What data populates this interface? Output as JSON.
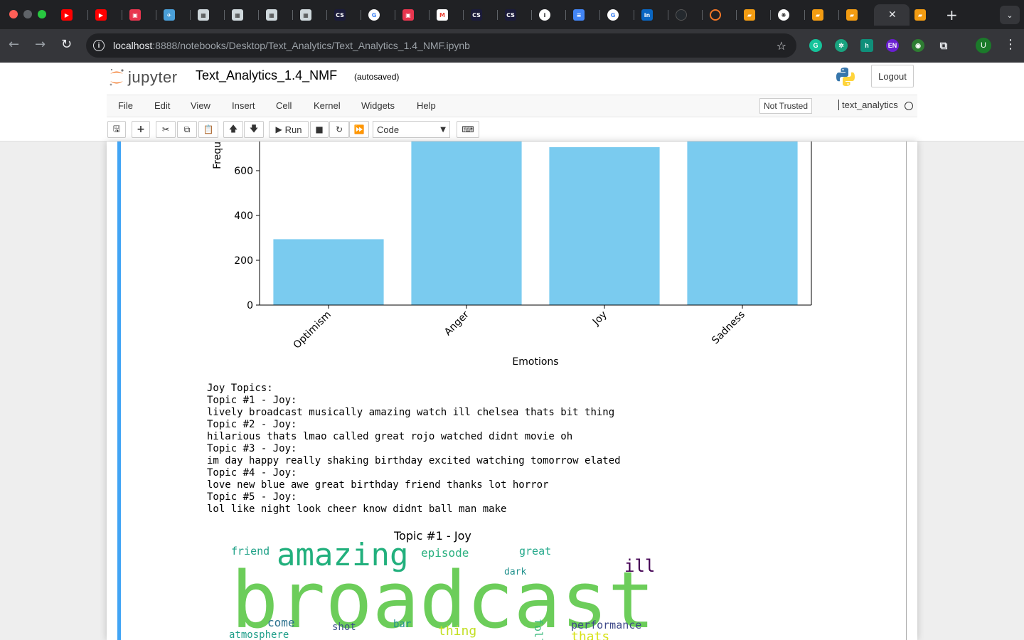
{
  "browser": {
    "url_host": "localhost",
    "url_rest": ":8888/notebooks/Desktop/Text_Analytics/Text_Analytics_1.4_NMF.ipynb",
    "profile_initial": "U",
    "ext_en": "EN",
    "ext_h": "h",
    "fav_cs": "CS",
    "icons": [
      "back-arrow-icon",
      "forward-arrow-icon",
      "reload-icon",
      "site-info-icon",
      "bookmark-star-icon",
      "grammarly-icon",
      "chatgpt-icon",
      "hypothesis-icon",
      "extensions-puzzle-icon",
      "menu-dots-icon"
    ]
  },
  "jupyter": {
    "logo_text": "jupyter",
    "notebook_name": "Text_Analytics_1.4_NMF",
    "autosave_status": "(autosaved)",
    "logout_label": "Logout",
    "menu": [
      "File",
      "Edit",
      "View",
      "Insert",
      "Cell",
      "Kernel",
      "Widgets",
      "Help"
    ],
    "trust_label": "Not Trusted",
    "kernel_name": "text_analytics",
    "run_label": "Run",
    "cell_type": "Code"
  },
  "chart_data": {
    "type": "bar",
    "categories": [
      "Optimism",
      "Anger",
      "Joy",
      "Sadness"
    ],
    "values": [
      294,
      750,
      705,
      750
    ],
    "xlabel": "Emotions",
    "ylabel": "Frequ",
    "yticks": [
      0,
      200,
      400,
      600
    ],
    "color": "#7acbef"
  },
  "output": {
    "lines": [
      "Joy Topics:",
      "Topic #1 - Joy:",
      "lively broadcast musically amazing watch ill chelsea thats bit thing",
      "Topic #2 - Joy:",
      "hilarious thats lmao called great rojo watched didnt movie oh",
      "Topic #3 - Joy:",
      "im day happy really shaking birthday excited watching tomorrow elated",
      "Topic #4 - Joy:",
      "love new blue awe great birthday friend thanks lot horror",
      "Topic #5 - Joy:",
      "lol like night look cheer know didnt ball man make"
    ]
  },
  "wordcloud": {
    "title": "Topic #1 - Joy",
    "words": [
      {
        "text": "friend",
        "color": "#1fa187"
      },
      {
        "text": "amazing",
        "color": "#22b07d"
      },
      {
        "text": "episode",
        "color": "#2ab07f"
      },
      {
        "text": "great",
        "color": "#25a98b"
      },
      {
        "text": "ill",
        "color": "#440154"
      },
      {
        "text": "dark",
        "color": "#21918c"
      },
      {
        "text": "broadcast",
        "color": "#6ccd5a"
      },
      {
        "text": "come",
        "color": "#2c728e"
      },
      {
        "text": "shot",
        "color": "#3b528b"
      },
      {
        "text": "bar",
        "color": "#21918c"
      },
      {
        "text": "thing",
        "color": "#c2df23"
      },
      {
        "text": "follow",
        "color": "#35b779"
      },
      {
        "text": "performance",
        "color": "#3e4989"
      },
      {
        "text": "atmosphere",
        "color": "#1f9e89"
      },
      {
        "text": "thats",
        "color": "#d8e219"
      }
    ]
  }
}
